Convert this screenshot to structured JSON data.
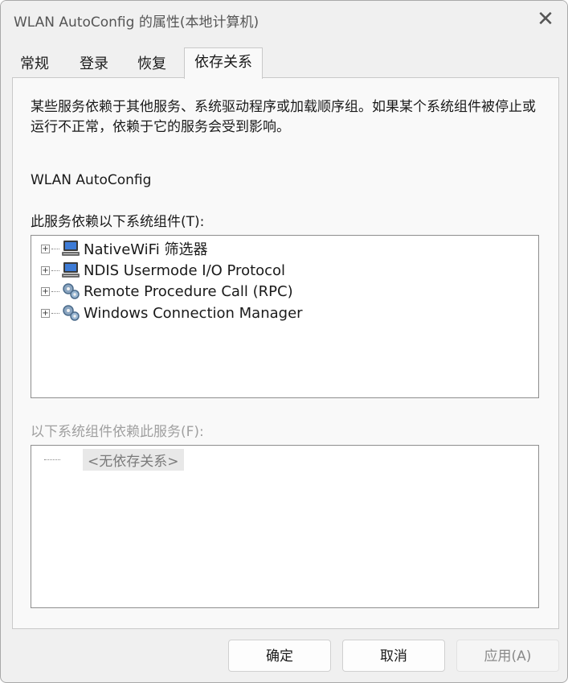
{
  "window": {
    "title": "WLAN AutoConfig 的属性(本地计算机)",
    "close_glyph": "✕"
  },
  "tabs": [
    {
      "label": "常规",
      "active": false
    },
    {
      "label": "登录",
      "active": false
    },
    {
      "label": "恢复",
      "active": false
    },
    {
      "label": "依存关系",
      "active": true
    }
  ],
  "panel": {
    "description": "某些服务依赖于其他服务、系统驱动程序或加载顺序组。如果某个系统组件被停止或运行不正常，依赖于它的服务会受到影响。",
    "service_name": "WLAN AutoConfig",
    "depends_on_label": "此服务依赖以下系统组件(T):",
    "depends_on": [
      {
        "label": "NativeWiFi 筛选器",
        "icon": "computer-icon"
      },
      {
        "label": "NDIS Usermode I/O Protocol",
        "icon": "computer-icon"
      },
      {
        "label": "Remote Procedure Call (RPC)",
        "icon": "gears-icon"
      },
      {
        "label": "Windows Connection Manager",
        "icon": "gears-icon"
      }
    ],
    "dependents_label": "以下系统组件依赖此服务(F):",
    "dependents_empty": "<无依存关系>"
  },
  "buttons": {
    "ok": "确定",
    "cancel": "取消",
    "apply": "应用(A)"
  },
  "colors": {
    "window_bg": "#f0f0f0",
    "panel_bg": "#f9f9f9",
    "disabled_text": "#a0a0a0"
  }
}
